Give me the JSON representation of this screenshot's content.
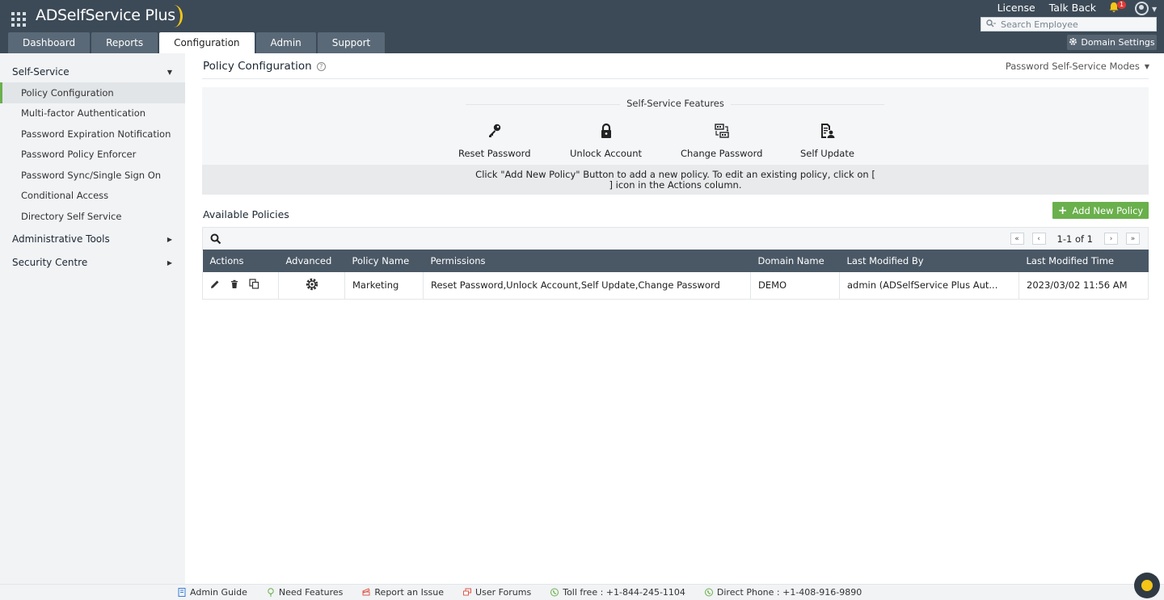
{
  "app": {
    "title": "ADSelfService Plus",
    "top_links": [
      "License",
      "Talk Back"
    ],
    "notification_count": "1",
    "search_placeholder": "Search Employee",
    "domain_settings": "Domain Settings"
  },
  "tabs": [
    {
      "label": "Dashboard",
      "active": false
    },
    {
      "label": "Reports",
      "active": false
    },
    {
      "label": "Configuration",
      "active": true
    },
    {
      "label": "Admin",
      "active": false
    },
    {
      "label": "Support",
      "active": false
    }
  ],
  "sidebar": {
    "groups": [
      {
        "label": "Self-Service",
        "expanded": true
      },
      {
        "label": "Administrative Tools",
        "expanded": false
      },
      {
        "label": "Security Centre",
        "expanded": false
      }
    ],
    "items": [
      {
        "label": "Policy Configuration",
        "active": true
      },
      {
        "label": "Multi-factor Authentication",
        "active": false
      },
      {
        "label": "Password Expiration Notification",
        "active": false
      },
      {
        "label": "Password Policy Enforcer",
        "active": false
      },
      {
        "label": "Password Sync/Single Sign On",
        "active": false
      },
      {
        "label": "Conditional Access",
        "active": false
      },
      {
        "label": "Directory Self Service",
        "active": false
      }
    ]
  },
  "main": {
    "title": "Policy Configuration",
    "modes_label": "Password Self-Service Modes",
    "features_title": "Self-Service Features",
    "features": [
      {
        "label": "Reset Password",
        "icon": "key-icon"
      },
      {
        "label": "Unlock Account",
        "icon": "lock-icon"
      },
      {
        "label": "Change Password",
        "icon": "change-password-icon"
      },
      {
        "label": "Self Update",
        "icon": "self-update-icon"
      }
    ],
    "info_line1": "Click \"Add New Policy\" Button to add a new policy. To edit an existing policy, click on [",
    "info_line2": "] icon in the Actions column.",
    "available_title": "Available Policies",
    "add_button": "Add New Policy",
    "pager_text": "1-1 of 1"
  },
  "table": {
    "headers": [
      "Actions",
      "Advanced",
      "Policy Name",
      "Permissions",
      "Domain Name",
      "Last Modified By",
      "Last Modified Time"
    ],
    "rows": [
      {
        "policy_name": "Marketing",
        "permissions": "Reset Password,Unlock Account,Self Update,Change Password",
        "domain": "DEMO",
        "modified_by": "admin (ADSelfService Plus Aut...",
        "modified_time": "2023/03/02 11:56 AM"
      }
    ]
  },
  "footer": {
    "links": [
      "Admin Guide",
      "Need Features",
      "Report an Issue",
      "User Forums",
      "Toll free : +1-844-245-1104",
      "Direct Phone : +1-408-916-9890"
    ]
  },
  "colors": {
    "header_bg": "#3c4a57",
    "accent_green": "#6ab04c",
    "table_header": "#4a5866"
  }
}
